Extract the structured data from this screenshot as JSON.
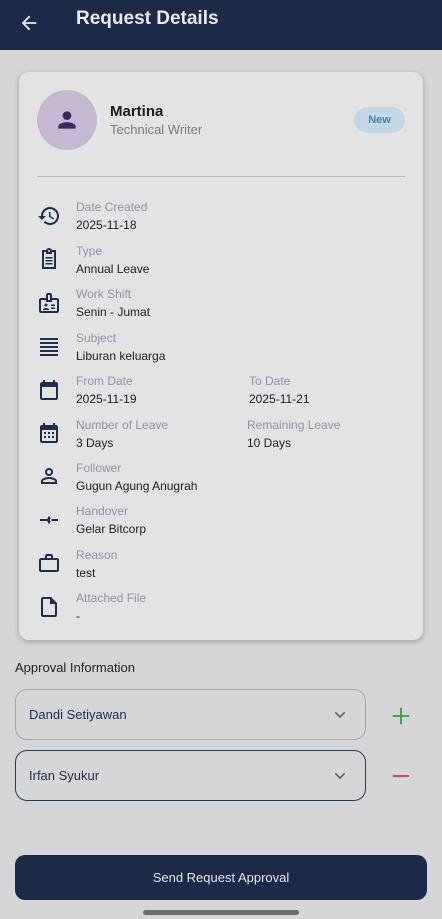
{
  "header": {
    "title": "Request Details"
  },
  "profile": {
    "name": "Martina",
    "role": "Technical Writer",
    "status": "New"
  },
  "fields": {
    "date_created": {
      "label": "Date Created",
      "value": "2025-11-18"
    },
    "type": {
      "label": "Type",
      "value": "Annual Leave"
    },
    "work_shift": {
      "label": "Work Shift",
      "value": "Senin - Jumat"
    },
    "subject": {
      "label": "Subject",
      "value": "Liburan keluarga"
    },
    "from_date": {
      "label": "From Date",
      "value": "2025-11-19"
    },
    "to_date": {
      "label": "To Date",
      "value": "2025-11-21"
    },
    "number_of_leave": {
      "label": "Number of Leave",
      "value": "3 Days"
    },
    "remaining_leave": {
      "label": "Remaining Leave",
      "value": "10 Days"
    },
    "follower": {
      "label": "Follower",
      "value": "Gugun Agung  Anugrah"
    },
    "handover": {
      "label": "Handover",
      "value": "Gelar Bitcorp"
    },
    "reason": {
      "label": "Reason",
      "value": "test"
    },
    "attached_file": {
      "label": "Attached File",
      "value": "-"
    }
  },
  "approval": {
    "title": "Approval Information",
    "approvers": [
      {
        "name": "Dandi Setiyawan"
      },
      {
        "name": "Irfan Syukur"
      }
    ]
  },
  "actions": {
    "send_label": "Send Request Approval"
  },
  "colors": {
    "primary": "#1b2a47",
    "add": "#3a9a3c",
    "remove": "#d33a3a",
    "badge_bg": "#c4d8e8",
    "badge_text": "#3f82b8"
  }
}
